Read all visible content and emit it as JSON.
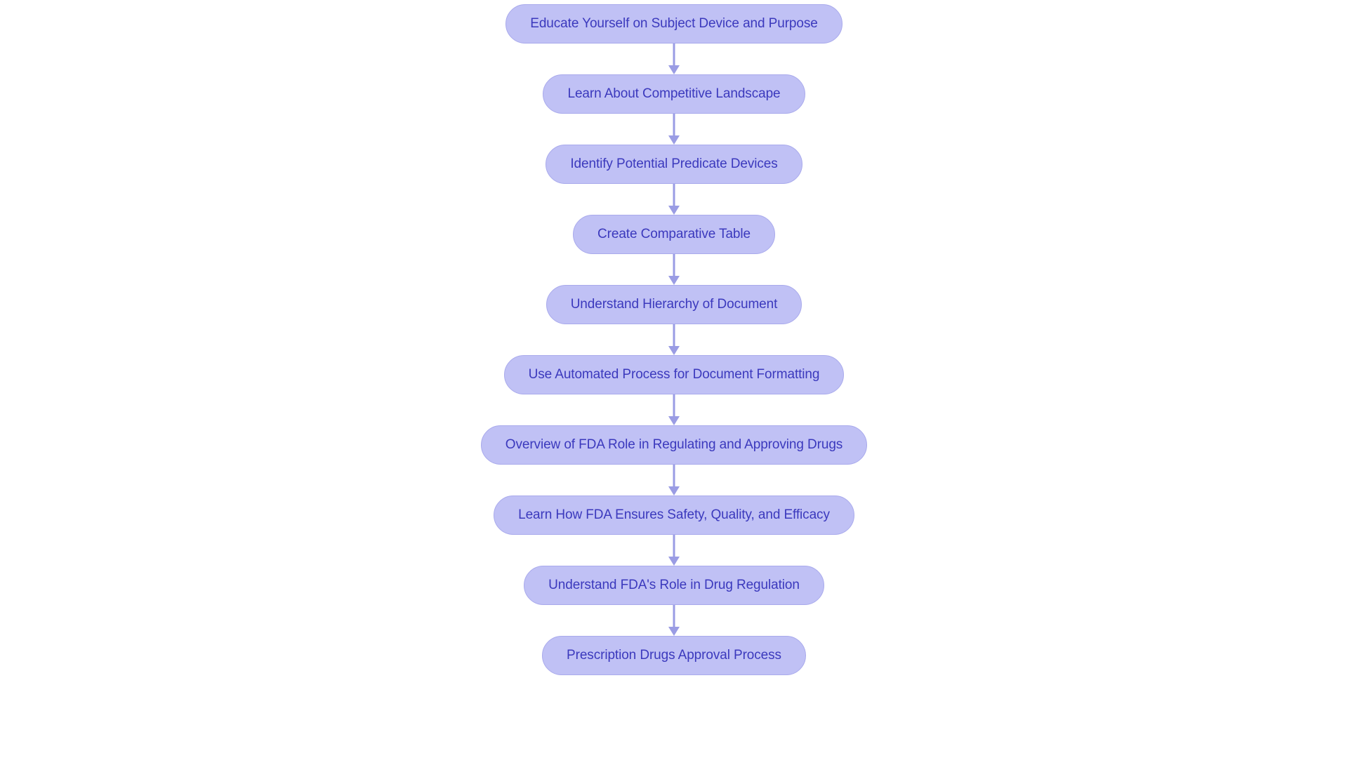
{
  "diagram": {
    "type": "flowchart",
    "orientation": "vertical-top-to-bottom",
    "background_color": "#ffffff",
    "node_fill_color": "#c0c1f5",
    "node_border_color": "#a9aaec",
    "node_text_color": "#3b39bd",
    "connector_color": "#9a9ce4",
    "node_shape": "rounded-pill",
    "nodes": [
      {
        "id": "n1",
        "label": "Educate Yourself on Subject Device and Purpose"
      },
      {
        "id": "n2",
        "label": "Learn About Competitive Landscape"
      },
      {
        "id": "n3",
        "label": "Identify Potential Predicate Devices"
      },
      {
        "id": "n4",
        "label": "Create Comparative Table"
      },
      {
        "id": "n5",
        "label": "Understand Hierarchy of Document"
      },
      {
        "id": "n6",
        "label": "Use Automated Process for Document Formatting"
      },
      {
        "id": "n7",
        "label": "Overview of FDA Role in Regulating and Approving Drugs"
      },
      {
        "id": "n8",
        "label": "Learn How FDA Ensures Safety, Quality, and Efficacy"
      },
      {
        "id": "n9",
        "label": "Understand FDA's Role in Drug Regulation"
      },
      {
        "id": "n10",
        "label": "Prescription Drugs Approval Process"
      }
    ],
    "edges": [
      {
        "from": "n1",
        "to": "n2",
        "arrow": "down"
      },
      {
        "from": "n2",
        "to": "n3",
        "arrow": "down"
      },
      {
        "from": "n3",
        "to": "n4",
        "arrow": "down"
      },
      {
        "from": "n4",
        "to": "n5",
        "arrow": "down"
      },
      {
        "from": "n5",
        "to": "n6",
        "arrow": "down"
      },
      {
        "from": "n6",
        "to": "n7",
        "arrow": "down"
      },
      {
        "from": "n7",
        "to": "n8",
        "arrow": "down"
      },
      {
        "from": "n8",
        "to": "n9",
        "arrow": "down"
      },
      {
        "from": "n9",
        "to": "n10",
        "arrow": "down"
      }
    ]
  }
}
